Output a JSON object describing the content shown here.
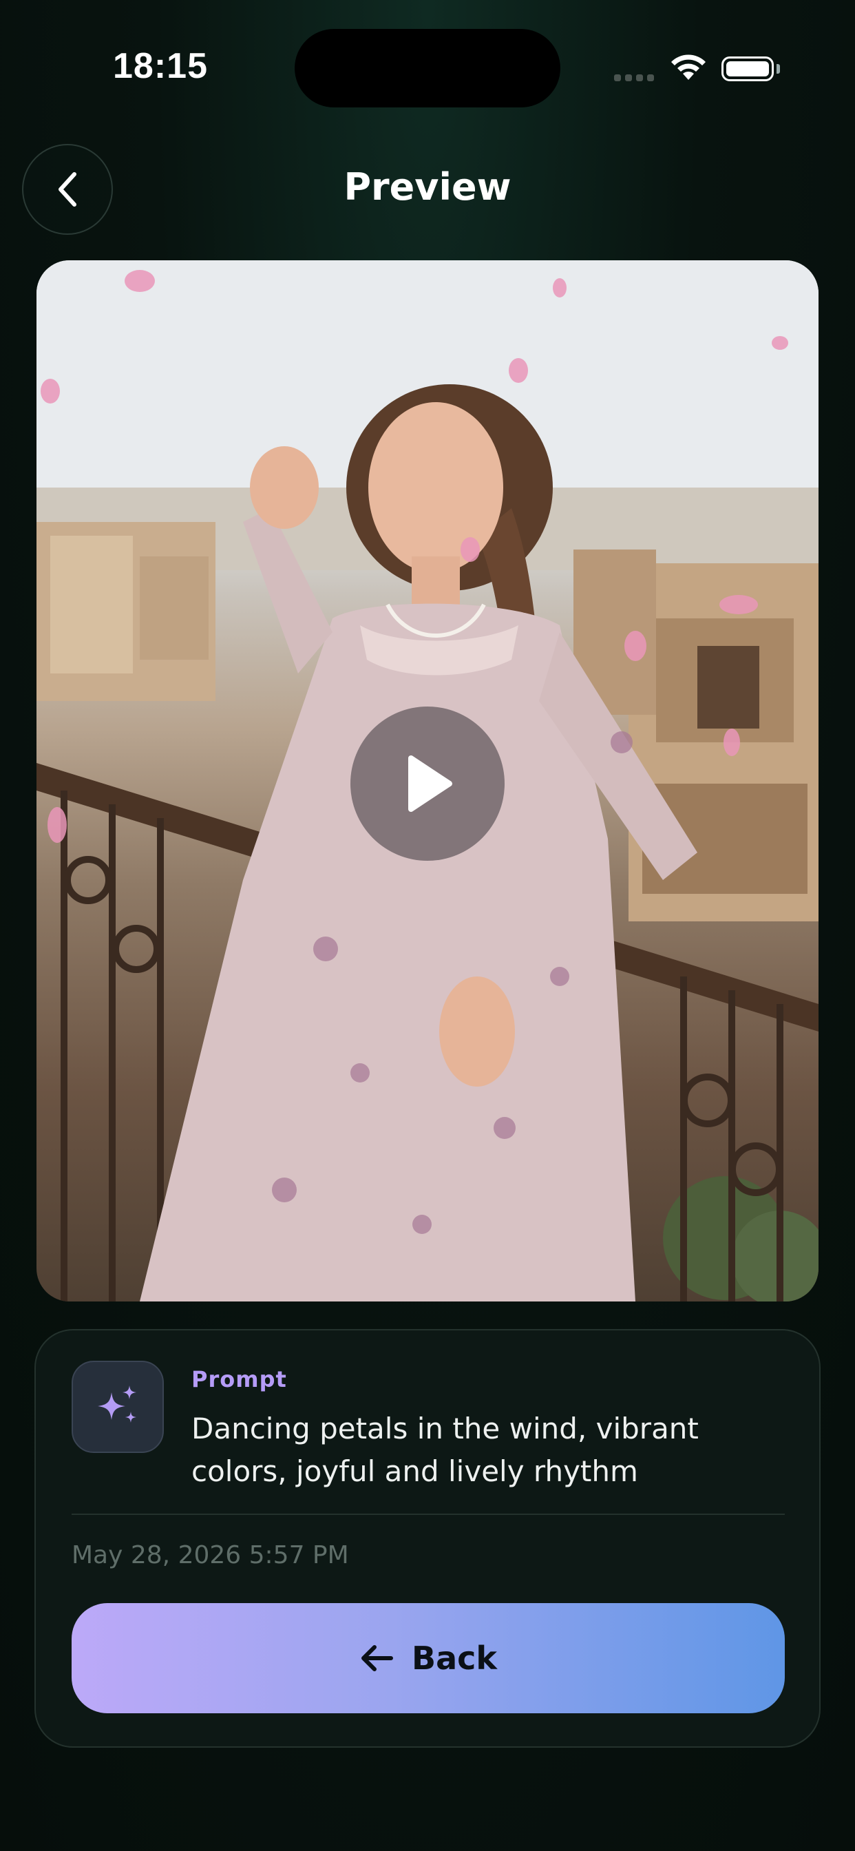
{
  "status_bar": {
    "time": "18:15",
    "icons": [
      "signal-icon",
      "wifi-icon",
      "battery-icon"
    ]
  },
  "header": {
    "title": "Preview",
    "back_icon": "chevron-left-icon"
  },
  "media": {
    "type": "video",
    "play_icon": "play-icon"
  },
  "prompt_card": {
    "icon": "sparkles-icon",
    "label": "Prompt",
    "text": "Dancing petals in the wind, vibrant colors, joyful and lively rhythm",
    "date": "May 28, 2026 5:57 PM",
    "back_button": {
      "label": "Back",
      "icon": "arrow-left-icon"
    }
  },
  "colors": {
    "background": "#08130f",
    "accent_label": "#b59cf7",
    "button_gradient_start": "#bca9f8",
    "button_gradient_end": "#5f96e6"
  }
}
